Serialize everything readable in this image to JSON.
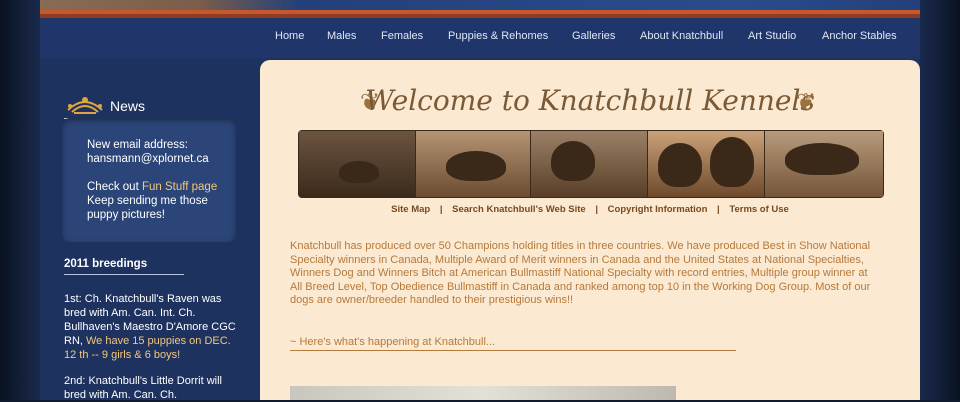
{
  "nav": {
    "items": [
      "Home",
      "Males",
      "Females",
      "Puppies & Rehomes",
      "Galleries",
      "About Knatchbull",
      "Art Studio",
      "Anchor Stables"
    ]
  },
  "sidebar": {
    "news_title": "News",
    "news_box": {
      "line1": "New email address:",
      "email": "hansmann@xplornet.ca",
      "check_out": "Check out",
      "fun_stuff": "Fun Stuff page",
      "keep1": "Keep sending me those",
      "keep2": "puppy pictures!"
    },
    "breedings_title": "2011 breedings",
    "breeding1": {
      "line1": "1st: Ch. Knatchbull's Raven was",
      "line2": "bred with Am. Can. Int. Ch.",
      "line3": "Bullhaven's Maestro D'Amore CGC",
      "line4_prefix": "RN, ",
      "line4_hl": "We have 15 puppies on DEC.",
      "line5_hl": "12 th -- 9 girls & 6 boys!"
    },
    "breeding2": {
      "line1": "2nd: Knatchbull's Little Dorrit will",
      "line2": "bred with Am. Can. Ch."
    }
  },
  "main": {
    "welcome": "Welcome to Knatchbull Kennels",
    "sublinks": [
      "Site Map",
      "Search Knatchbull's Web Site",
      "Copyright Information",
      "Terms of Use"
    ],
    "separator": "|",
    "intro": "Knatchbull has produced over 50 Champions holding titles in three countries. We have produced Best in Show National Specialty winners in Canada, Multiple Award of Merit winners in Canada and the United States at National Specialties, Winners Dog and Winners Bitch at American Bullmastiff National Specialty with record entries, Multiple group winner at All Breed Level, Top Obedience Bullmastiff in Canada and ranked among top 10 in the Working Dog Group. Most of our dogs are owner/breeder handled to their prestigious wins!!",
    "happening": "~ Here's what's happening at Knatchbull..."
  },
  "colors": {
    "page_bg": "#0f1a2f",
    "nav_bg": "#20356a",
    "content_bg": "#fbe9d2",
    "accent_text": "#b67a3a",
    "highlight": "#f3c77a"
  }
}
